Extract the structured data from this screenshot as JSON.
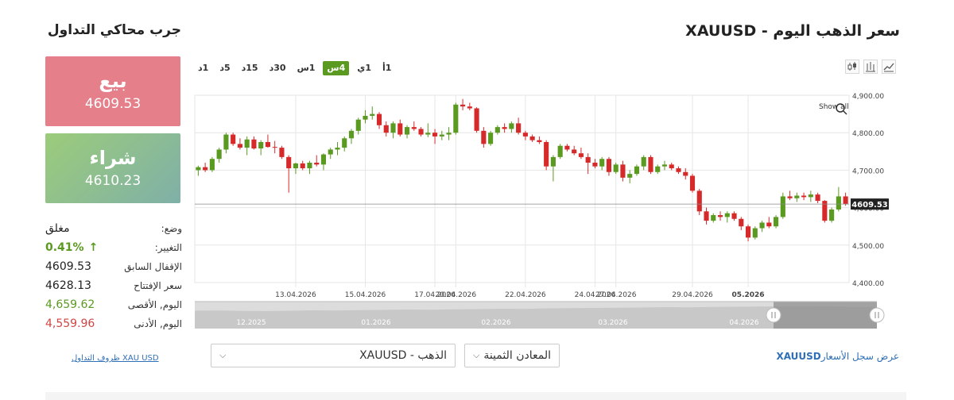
{
  "panel": {
    "title": "جرب محاكي التداول",
    "sell_label": "بيع",
    "sell_price": "4609.53",
    "buy_label": "شراء",
    "buy_price": "4610.23",
    "status_label": "وضع:",
    "status_value": "مغلق",
    "change_label": "التغيير:",
    "change_value": "0.41%",
    "prev_close_label": "الإقفال السابق",
    "prev_close_value": "4609.53",
    "open_label": "سعر الإفتتاح",
    "open_value": "4628.13",
    "high_label": "اليوم, الأقصى",
    "high_value": "4,659.62",
    "low_label": "اليوم, الأدنى",
    "low_value": "4,559.96",
    "conditions_link": "XAU USD ظروف التداول"
  },
  "header": {
    "title": "سعر الذهب اليوم - XAUUSD",
    "timeframes": [
      "1د",
      "5د",
      "15د",
      "30د",
      "1س",
      "4س",
      "1ي",
      "1أ"
    ],
    "active_timeframe": "4س"
  },
  "controls": {
    "symbol_select": "XAUUSD - الذهب",
    "category_select": "المعادن الثمينة",
    "history_symbol": "XAUUSD",
    "history_text": "عرض سجل الأسعار"
  },
  "colors": {
    "up": "#5b9a20",
    "down": "#d62a2a",
    "sell": "#e57f8a",
    "accent": "#5b9a20"
  },
  "chart_data": {
    "type": "candlestick",
    "symbol": "XAUUSD",
    "current_price_label": "4609.53",
    "showall_label": "Show all",
    "ylim": [
      4400,
      4900
    ],
    "yticks": [
      4900,
      4800,
      4700,
      4600,
      4500,
      4400
    ],
    "ytick_labels": [
      "4,900.00",
      "4,800.00",
      "4,700.00",
      "4,600.00",
      "4,500.00",
      "4,400.00"
    ],
    "xtick_labels": [
      {
        "i": 14,
        "label": "13.04.2026"
      },
      {
        "i": 24,
        "label": "15.04.2026"
      },
      {
        "i": 34,
        "label": "17.04.2026"
      },
      {
        "i": 37,
        "label": "20.04.2026"
      },
      {
        "i": 47,
        "label": "22.04.2026"
      },
      {
        "i": 57,
        "label": "24.04.2026"
      },
      {
        "i": 60,
        "label": "27.04.2026"
      },
      {
        "i": 71,
        "label": "29.04.2026"
      },
      {
        "i": 79,
        "label": "05.2026"
      }
    ],
    "navigator_labels": [
      "12.2025",
      "01.2026",
      "02.2026",
      "03.2026",
      "04.2026"
    ],
    "candles": [
      [
        4700,
        4712,
        4685,
        4708
      ],
      [
        4708,
        4720,
        4695,
        4700
      ],
      [
        4700,
        4735,
        4695,
        4730
      ],
      [
        4730,
        4760,
        4720,
        4755
      ],
      [
        4755,
        4800,
        4745,
        4795
      ],
      [
        4795,
        4800,
        4765,
        4770
      ],
      [
        4770,
        4785,
        4755,
        4760
      ],
      [
        4760,
        4790,
        4740,
        4782
      ],
      [
        4782,
        4790,
        4755,
        4758
      ],
      [
        4758,
        4780,
        4740,
        4775
      ],
      [
        4775,
        4795,
        4760,
        4762
      ],
      [
        4762,
        4778,
        4745,
        4760
      ],
      [
        4760,
        4765,
        4730,
        4735
      ],
      [
        4735,
        4740,
        4640,
        4705
      ],
      [
        4705,
        4720,
        4690,
        4718
      ],
      [
        4718,
        4725,
        4700,
        4705
      ],
      [
        4705,
        4725,
        4690,
        4720
      ],
      [
        4720,
        4740,
        4710,
        4715
      ],
      [
        4715,
        4745,
        4700,
        4742
      ],
      [
        4742,
        4760,
        4730,
        4755
      ],
      [
        4755,
        4775,
        4740,
        4760
      ],
      [
        4760,
        4790,
        4750,
        4785
      ],
      [
        4785,
        4810,
        4770,
        4805
      ],
      [
        4805,
        4840,
        4795,
        4835
      ],
      [
        4835,
        4860,
        4825,
        4845
      ],
      [
        4845,
        4870,
        4835,
        4850
      ],
      [
        4850,
        4855,
        4810,
        4820
      ],
      [
        4820,
        4830,
        4790,
        4800
      ],
      [
        4800,
        4830,
        4785,
        4825
      ],
      [
        4825,
        4835,
        4790,
        4795
      ],
      [
        4795,
        4820,
        4785,
        4815
      ],
      [
        4815,
        4830,
        4805,
        4810
      ],
      [
        4810,
        4815,
        4790,
        4795
      ],
      [
        4795,
        4825,
        4788,
        4800
      ],
      [
        4800,
        4810,
        4770,
        4790
      ],
      [
        4790,
        4805,
        4780,
        4795
      ],
      [
        4795,
        4815,
        4780,
        4800
      ],
      [
        4800,
        4880,
        4795,
        4875
      ],
      [
        4875,
        4890,
        4860,
        4870
      ],
      [
        4870,
        4880,
        4860,
        4865
      ],
      [
        4865,
        4868,
        4800,
        4805
      ],
      [
        4805,
        4815,
        4760,
        4770
      ],
      [
        4770,
        4805,
        4765,
        4800
      ],
      [
        4800,
        4820,
        4795,
        4815
      ],
      [
        4815,
        4825,
        4800,
        4810
      ],
      [
        4810,
        4830,
        4800,
        4825
      ],
      [
        4825,
        4840,
        4795,
        4800
      ],
      [
        4800,
        4805,
        4780,
        4790
      ],
      [
        4790,
        4795,
        4775,
        4780
      ],
      [
        4780,
        4790,
        4770,
        4775
      ],
      [
        4775,
        4780,
        4700,
        4710
      ],
      [
        4710,
        4740,
        4670,
        4735
      ],
      [
        4735,
        4770,
        4730,
        4765
      ],
      [
        4765,
        4770,
        4750,
        4755
      ],
      [
        4755,
        4765,
        4740,
        4745
      ],
      [
        4745,
        4760,
        4730,
        4735
      ],
      [
        4735,
        4745,
        4690,
        4720
      ],
      [
        4720,
        4730,
        4705,
        4710
      ],
      [
        4710,
        4735,
        4700,
        4730
      ],
      [
        4730,
        4735,
        4685,
        4695
      ],
      [
        4695,
        4720,
        4690,
        4715
      ],
      [
        4715,
        4725,
        4670,
        4680
      ],
      [
        4680,
        4700,
        4665,
        4690
      ],
      [
        4690,
        4715,
        4685,
        4710
      ],
      [
        4710,
        4740,
        4700,
        4735
      ],
      [
        4735,
        4740,
        4690,
        4695
      ],
      [
        4695,
        4715,
        4690,
        4710
      ],
      [
        4710,
        4725,
        4700,
        4715
      ],
      [
        4715,
        4720,
        4700,
        4705
      ],
      [
        4705,
        4710,
        4690,
        4695
      ],
      [
        4695,
        4705,
        4675,
        4685
      ],
      [
        4685,
        4690,
        4640,
        4645
      ],
      [
        4645,
        4650,
        4580,
        4590
      ],
      [
        4590,
        4600,
        4555,
        4565
      ],
      [
        4565,
        4585,
        4560,
        4580
      ],
      [
        4580,
        4590,
        4565,
        4575
      ],
      [
        4575,
        4590,
        4560,
        4585
      ],
      [
        4585,
        4590,
        4565,
        4570
      ],
      [
        4570,
        4575,
        4540,
        4550
      ],
      [
        4550,
        4555,
        4510,
        4520
      ],
      [
        4520,
        4550,
        4515,
        4545
      ],
      [
        4545,
        4565,
        4535,
        4560
      ],
      [
        4560,
        4575,
        4545,
        4550
      ],
      [
        4550,
        4580,
        4545,
        4575
      ],
      [
        4575,
        4640,
        4570,
        4630
      ],
      [
        4630,
        4645,
        4620,
        4625
      ],
      [
        4625,
        4640,
        4615,
        4632
      ],
      [
        4632,
        4640,
        4620,
        4628
      ],
      [
        4628,
        4645,
        4615,
        4635
      ],
      [
        4635,
        4640,
        4612,
        4618
      ],
      [
        4618,
        4620,
        4560,
        4565
      ],
      [
        4565,
        4600,
        4560,
        4595
      ],
      [
        4595,
        4655,
        4590,
        4630
      ],
      [
        4630,
        4640,
        4605,
        4610
      ]
    ]
  }
}
